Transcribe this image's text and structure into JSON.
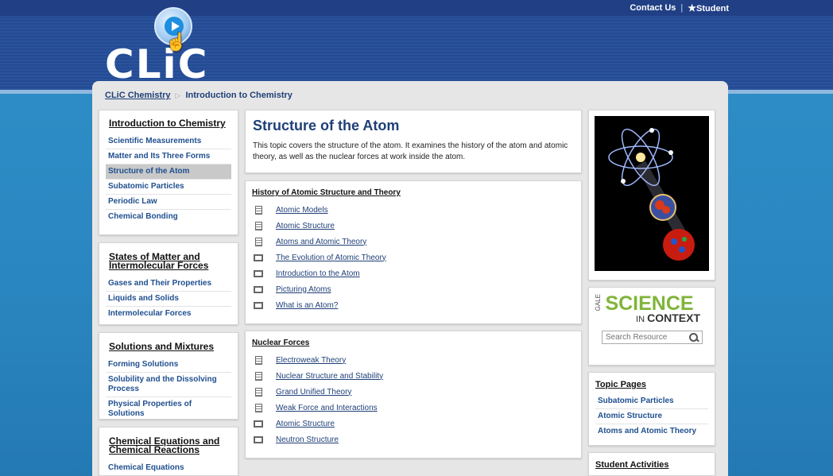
{
  "header": {
    "contact_label": "Contact Us",
    "separator": "|",
    "student_label": "Student",
    "logo_text": "CLiC"
  },
  "breadcrumb": {
    "home": "CLiC Chemistry",
    "current": "Introduction to Chemistry"
  },
  "nav": {
    "intro": {
      "title": "Introduction to Chemistry",
      "items": [
        "Scientific Measurements",
        "Matter and Its Three Forms",
        "Structure of the Atom",
        "Subatomic Particles",
        "Periodic Law",
        "Chemical Bonding"
      ]
    },
    "states": {
      "title": "States of Matter and Intermolecular Forces",
      "items": [
        "Gases and Their Properties",
        "Liquids and Solids",
        "Intermolecular Forces"
      ]
    },
    "solutions": {
      "title": "Solutions and Mixtures",
      "items": [
        "Forming Solutions",
        "Solubility and the Dissolving Process",
        "Physical Properties of Solutions"
      ]
    },
    "equations": {
      "title": "Chemical Equations and Chemical Reactions",
      "items": [
        "Chemical Equations"
      ]
    }
  },
  "main": {
    "title": "Structure of the Atom",
    "description": "This topic covers the structure of the atom. It examines the history of the atom and atomic theory, as well as the nuclear forces at work inside the atom."
  },
  "history": {
    "title": "History of Atomic Structure and Theory",
    "items": [
      "Atomic Models",
      "Atomic Structure",
      "Atoms and Atomic Theory",
      "The Evolution of Atomic Theory",
      "Introduction to the Atom",
      "Picturing Atoms",
      "What is an Atom?"
    ]
  },
  "nuclear": {
    "title": "Nuclear Forces",
    "items": [
      "Electroweak Theory",
      "Nuclear Structure and Stability",
      "Grand Unified Theory",
      "Weak Force and Interactions",
      "Atomic Structure",
      "Neutron Structure"
    ]
  },
  "sic": {
    "gale": "GALE",
    "science": "SCIENCE",
    "in": "IN",
    "context": "CONTEXT",
    "search_placeholder": "Search Resource"
  },
  "topic_pages": {
    "title": "Topic Pages",
    "items": [
      "Subatomic Particles",
      "Atomic Structure",
      "Atoms and Atomic Theory"
    ]
  },
  "student_activities": {
    "title": "Student Activities"
  },
  "colors": {
    "header": "#244b94",
    "link": "#1f3f78",
    "brand_green": "#7fb53a"
  }
}
